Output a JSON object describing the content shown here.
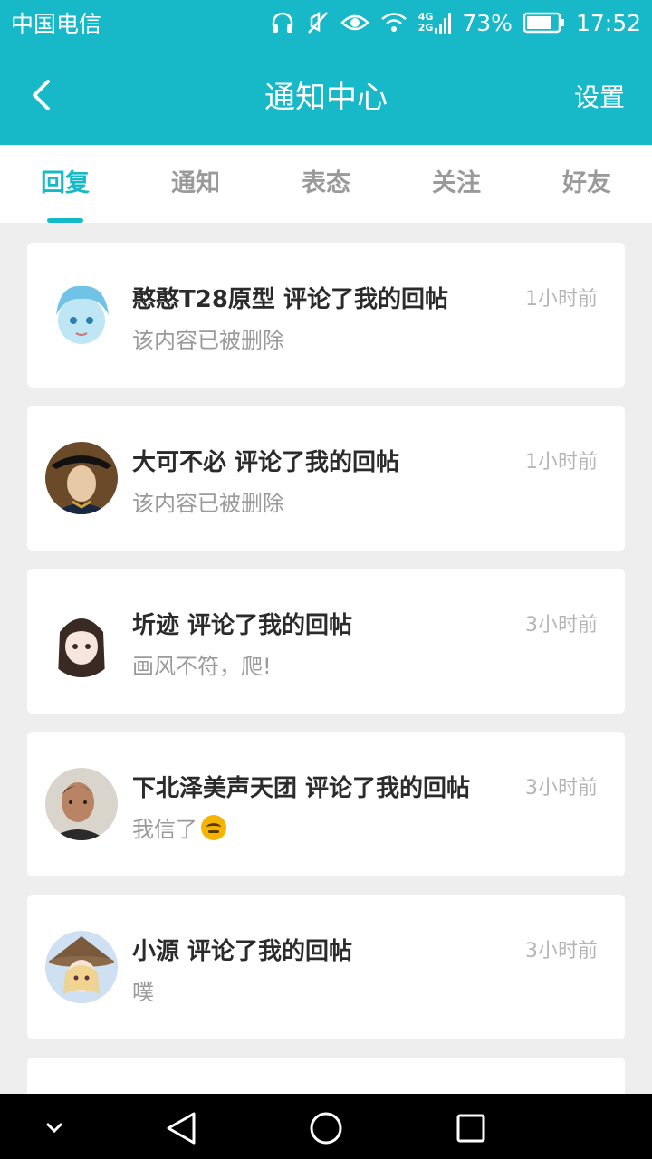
{
  "status": {
    "carrier": "中国电信",
    "battery": "73%",
    "time": "17:52",
    "network_4g": "4G",
    "network_2g": "2G"
  },
  "header": {
    "title": "通知中心",
    "settings": "设置"
  },
  "tabs": [
    {
      "label": "回复",
      "active": true
    },
    {
      "label": "通知"
    },
    {
      "label": "表态"
    },
    {
      "label": "关注"
    },
    {
      "label": "好友"
    }
  ],
  "notifications": [
    {
      "title": "憨憨T28原型 评论了我的回帖",
      "time": "1小时前",
      "message": "该内容已被删除"
    },
    {
      "title": "大可不必 评论了我的回帖",
      "time": "1小时前",
      "message": "该内容已被删除"
    },
    {
      "title": "圻迹 评论了我的回帖",
      "time": "3小时前",
      "message": "画风不符，爬!"
    },
    {
      "title": "下北泽美声天团 评论了我的回帖",
      "time": "3小时前",
      "message": "我信了"
    },
    {
      "title": "小源 评论了我的回帖",
      "time": "3小时前",
      "message": "噗"
    }
  ],
  "colors": {
    "primary": "#17b9c9",
    "background": "#eeeeee"
  }
}
